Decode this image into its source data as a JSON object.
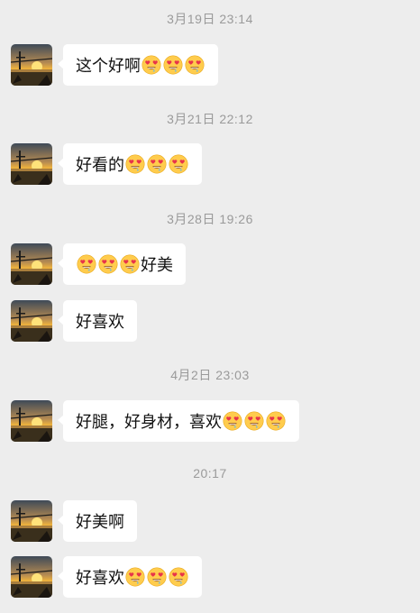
{
  "colors": {
    "background": "#ededed",
    "bubble": "#ffffff",
    "timestamp_text": "#9a9a9a",
    "message_text": "#111111"
  },
  "avatar_icon": "sunset-bridge-avatar-icon",
  "emoji_icon": "heart-eyes-drooling-emoji-icon",
  "timestamps": [
    "3月19日 23:14",
    "3月21日 22:12",
    "3月28日 19:26",
    "4月2日 23:03",
    "20:17"
  ],
  "messages": [
    {
      "before": "",
      "text": "这个好啊",
      "emoji_before": 0,
      "emoji_after": 3
    },
    {
      "before": "",
      "text": "好看的",
      "emoji_before": 0,
      "emoji_after": 3
    },
    {
      "before": "",
      "text": "好美",
      "emoji_before": 3,
      "emoji_after": 0
    },
    {
      "before": "",
      "text": "好喜欢",
      "emoji_before": 0,
      "emoji_after": 0
    },
    {
      "before": "",
      "text": "好腿，好身材，喜欢",
      "emoji_before": 0,
      "emoji_after": 3
    },
    {
      "before": "",
      "text": "好美啊",
      "emoji_before": 0,
      "emoji_after": 0
    },
    {
      "before": "",
      "text": "好喜欢",
      "emoji_before": 0,
      "emoji_after": 3
    }
  ]
}
